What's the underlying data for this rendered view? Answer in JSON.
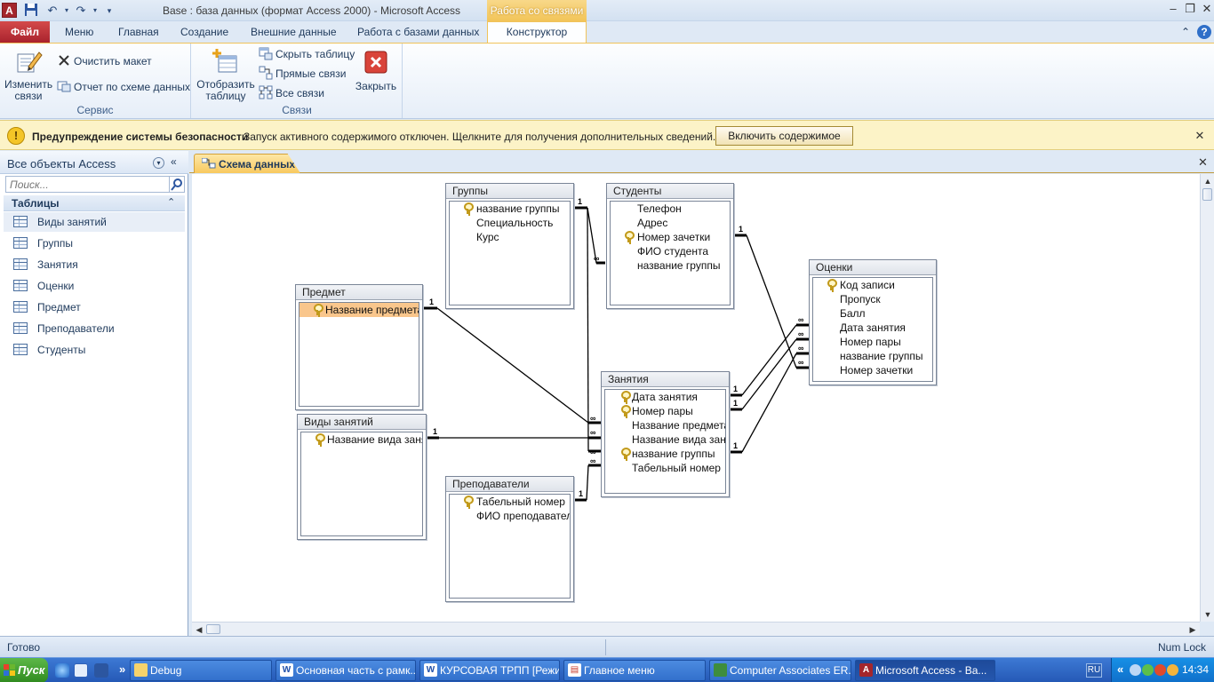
{
  "window": {
    "title": "Base : база данных (формат Access 2000)  -  Microsoft Access",
    "context_header": "Работа со связями",
    "logo_letter": "A"
  },
  "ribbon_tabs": {
    "file": "Файл",
    "items": [
      "Меню",
      "Главная",
      "Создание",
      "Внешние данные",
      "Работа с базами данных"
    ],
    "active": "Конструктор"
  },
  "ribbon": {
    "edit_relations": "Изменить\nсвязи",
    "edit_relations_l1": "Изменить",
    "edit_relations_l2": "связи",
    "clear_layout": "Очистить макет",
    "relation_report": "Отчет по схеме данных",
    "group_service": "Сервис",
    "show_table_l1": "Отобразить",
    "show_table_l2": "таблицу",
    "hide_table": "Скрыть таблицу",
    "direct_links": "Прямые связи",
    "all_links": "Все связи",
    "close": "Закрыть",
    "group_links": "Связи"
  },
  "message_bar": {
    "title": "Предупреждение системы безопасности",
    "text": "Запуск активного содержимого отключен. Щелкните для получения дополнительных сведений.",
    "button": "Включить содержимое"
  },
  "nav": {
    "title": "Все объекты Access",
    "search_placeholder": "Поиск...",
    "group": "Таблицы",
    "items": [
      "Виды занятий",
      "Группы",
      "Занятия",
      "Оценки",
      "Предмет",
      "Преподаватели",
      "Студенты"
    ]
  },
  "document": {
    "tab": "Схема данных"
  },
  "tables": {
    "gruppy": {
      "title": "Группы",
      "fields": [
        {
          "name": "название группы",
          "key": true
        },
        {
          "name": "Специальность",
          "key": false
        },
        {
          "name": "Курс",
          "key": false
        }
      ]
    },
    "studenty": {
      "title": "Студенты",
      "fields": [
        {
          "name": "Телефон",
          "key": false
        },
        {
          "name": "Адрес",
          "key": false
        },
        {
          "name": "Номер зачетки",
          "key": true
        },
        {
          "name": "ФИО студента",
          "key": false
        },
        {
          "name": "название группы",
          "key": false
        }
      ]
    },
    "predmet": {
      "title": "Предмет",
      "fields": [
        {
          "name": "Название предмета",
          "key": true
        }
      ]
    },
    "vidy": {
      "title": "Виды занятий",
      "fields": [
        {
          "name": "Название вида занятия",
          "key": true
        }
      ]
    },
    "zanyatiya": {
      "title": "Занятия",
      "fields": [
        {
          "name": "Дата занятия",
          "key": true
        },
        {
          "name": "Номер пары",
          "key": true
        },
        {
          "name": "Название предмета",
          "key": false
        },
        {
          "name": "Название вида занятия",
          "key": false
        },
        {
          "name": "название группы",
          "key": true
        },
        {
          "name": "Табельный номер",
          "key": false
        }
      ]
    },
    "prepodavateli": {
      "title": "Преподаватели",
      "fields": [
        {
          "name": "Табельный номер",
          "key": true
        },
        {
          "name": "ФИО преподавателя",
          "key": false
        }
      ]
    },
    "ocenki": {
      "title": "Оценки",
      "fields": [
        {
          "name": "Код записи",
          "key": true
        },
        {
          "name": "Пропуск",
          "key": false
        },
        {
          "name": "Балл",
          "key": false
        },
        {
          "name": "Дата занятия",
          "key": false
        },
        {
          "name": "Номер пары",
          "key": false
        },
        {
          "name": "название группы",
          "key": false
        },
        {
          "name": "Номер зачетки",
          "key": false
        }
      ]
    }
  },
  "relations": {
    "one": "1",
    "many": "∞"
  },
  "status": {
    "text": "Готово",
    "numlock": "Num Lock"
  },
  "taskbar": {
    "start": "Пуск",
    "buttons": [
      "Debug",
      "Основная часть с рамк...",
      "КУРСОВАЯ ТРПП [Режи...",
      "Главное меню",
      "Computer Associates ER...",
      "Microsoft Access - Ba..."
    ],
    "lang": "RU",
    "clock": "14:34"
  }
}
